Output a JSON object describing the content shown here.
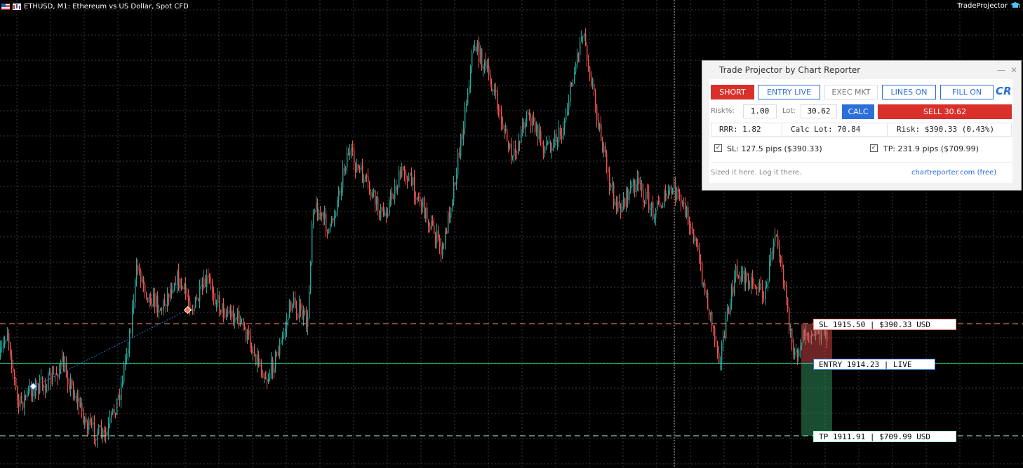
{
  "header": {
    "symbol_text": "ETHUSD, M1:  Ethereum vs US Dollar, Spot CFD",
    "right_label": "TradeProjector"
  },
  "chart_data": {
    "type": "candlestick",
    "symbol": "ETHUSD",
    "timeframe": "M1",
    "levels": {
      "sl": 1915.5,
      "entry": 1914.23,
      "tp": 1911.91
    },
    "background": "#000000",
    "grid": true,
    "candle_up_color": "#26a69a",
    "candle_down_color": "#ef5350"
  },
  "level_labels": {
    "sl": "SL 1915.50 | $390.33 USD",
    "entry": "ENTRY 1914.23 | LIVE",
    "tp": "TP 1911.91 | $709.99 USD"
  },
  "colors": {
    "sl_line": "#ff8a80",
    "entry_line": "#2bd68a",
    "tp_line": "#a0ffd0",
    "brand_red": "#d9302b",
    "brand_blue": "#2b6fd9"
  },
  "panel": {
    "title": "Trade Projector by Chart Reporter",
    "minimize": "—",
    "close": "✕",
    "buttons": {
      "short": "SHORT",
      "entry_live": "ENTRY LIVE",
      "exec_mkt": "EXEC MKT",
      "lines_on": "LINES ON",
      "fill_on": "FILL ON",
      "logo": "CR",
      "calc": "CALC",
      "sell": "SELL 30.62"
    },
    "risk_label": "Risk%:",
    "risk_value": "1.00",
    "lot_label": "Lot:",
    "lot_value": "30.62",
    "stats": {
      "rrr": "RRR: 1.82",
      "calc_lot": "Calc Lot: 70.84",
      "risk": "Risk: $390.33 (0.43%)"
    },
    "sl_check": "SL: 127.5 pips ($390.33)",
    "tp_check": "TP: 231.9 pips ($709.99)",
    "check_mark": "✓",
    "footer_left": "Sized it here. Log it there.",
    "footer_right": "chartreporter.com (free)"
  }
}
